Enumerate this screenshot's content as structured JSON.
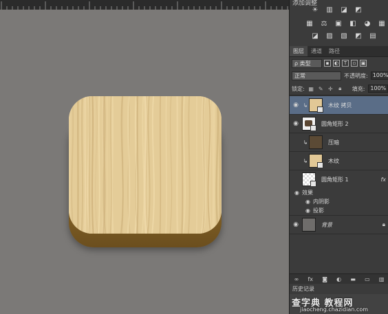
{
  "adjustments": {
    "title": "添加调整",
    "row1_icons": [
      "brightness-icon",
      "levels-icon",
      "curves-icon",
      "exposure-icon"
    ],
    "row2_icons": [
      "vibrance-icon",
      "hue-saturation-icon",
      "color-balance-icon",
      "black-white-icon",
      "photo-filter-icon",
      "channel-mixer-icon"
    ],
    "row3_icons": [
      "invert-icon",
      "posterize-icon",
      "threshold-icon",
      "selective-color-icon",
      "gradient-map-icon"
    ]
  },
  "layers_panel": {
    "tabs": [
      "图层",
      "通道",
      "路径"
    ],
    "filter_label": "ρ 类型",
    "blend_mode": "正常",
    "opacity_label": "不透明度:",
    "opacity_value": "100%",
    "lock_label": "锁定:",
    "fill_label": "填充:",
    "fill_value": "100%",
    "layers": [
      {
        "name": "木纹 拷贝",
        "selected": true,
        "clipped": true,
        "thumb_color": "#e2c896"
      },
      {
        "name": "圆角矩形 2",
        "selected": false,
        "clipped": false,
        "thumb_color": "#5a4632"
      },
      {
        "name": "压暗",
        "selected": false,
        "clipped": true,
        "thumb_color": "#5b4a35"
      },
      {
        "name": "木纹",
        "selected": false,
        "clipped": true,
        "thumb_color": "#e2c896"
      },
      {
        "name": "圆角矩形 1",
        "selected": false,
        "clipped": false,
        "thumb_color": "#f2f2f2",
        "fx": "fx"
      },
      {
        "name": "背景",
        "selected": false,
        "clipped": false,
        "thumb_color": "#6f6d6b"
      }
    ],
    "effects": {
      "label": "效果",
      "items": [
        "内阴影",
        "投影"
      ]
    },
    "bottom_icons": [
      "link-icon",
      "fx-icon",
      "mask-icon",
      "adjustment-icon",
      "folder-icon",
      "new-layer-icon",
      "trash-icon"
    ]
  },
  "history": {
    "title": "历史记录"
  },
  "watermark": {
    "text": "查字典 教程网",
    "url": "jiaocheng.chazidian.com"
  },
  "colors": {
    "canvas_bg": "#7b7977",
    "panel_bg": "#3b3b3b",
    "selected_layer": "#5a6d87",
    "wood_light": "#e4cc98",
    "wood_dark": "#8d6a2a"
  }
}
